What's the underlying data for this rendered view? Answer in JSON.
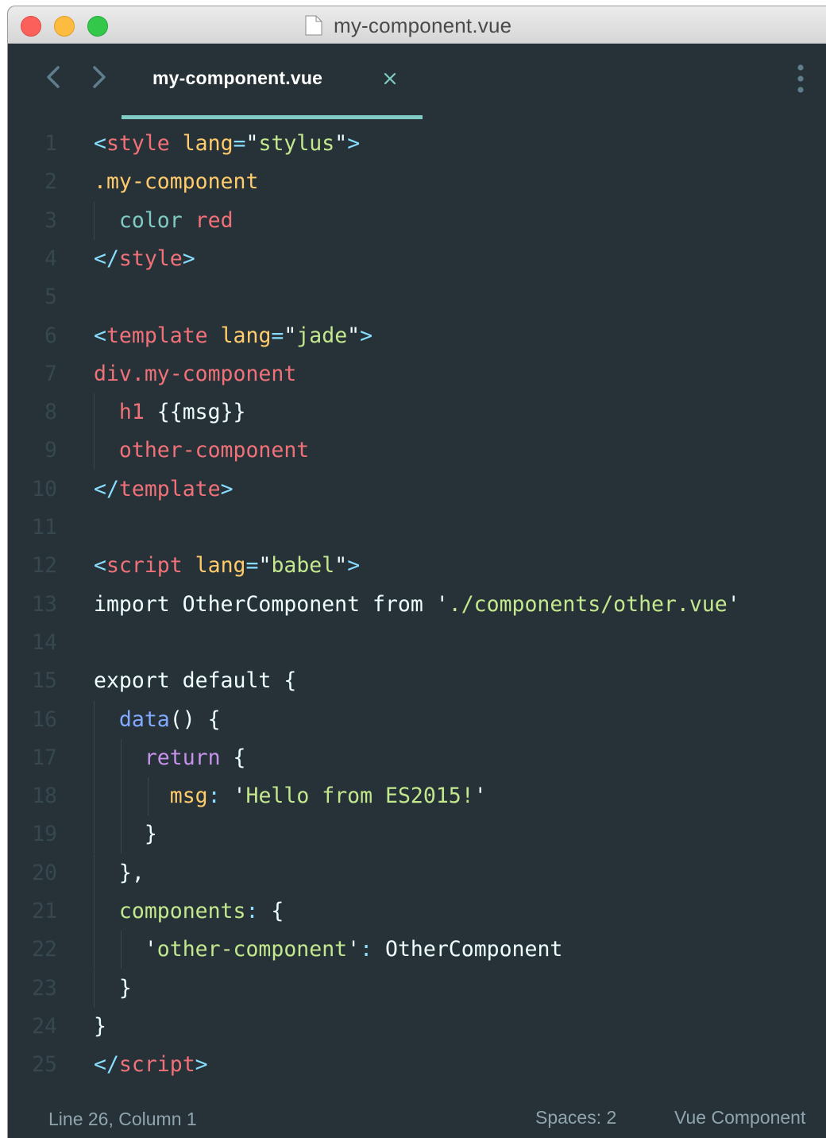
{
  "window": {
    "title": "my-component.vue",
    "title_icon": "document-icon"
  },
  "tabs": [
    {
      "label": "my-component.vue",
      "close_icon": "close-icon",
      "active": true
    }
  ],
  "nav": {
    "back_icon": "chevron-left-icon",
    "forward_icon": "chevron-right-icon",
    "menu_icon": "more-vertical-icon"
  },
  "colors": {
    "background": "#263238",
    "tab_accent": "#80cbc4",
    "tag": "#f07178",
    "punctuation": "#89ddff",
    "attribute": "#ffcb6b",
    "string": "#c3e88d",
    "keyword": "#c792ea",
    "function": "#82aaff",
    "property": "#80cbc4",
    "line_number": "#37474f"
  },
  "editor": {
    "lines": [
      {
        "n": "1",
        "tokens": [
          [
            "<",
            "p"
          ],
          [
            "style",
            "t"
          ],
          [
            " ",
            "x"
          ],
          [
            "lang",
            "a"
          ],
          [
            "=",
            "p"
          ],
          [
            "\"",
            "x"
          ],
          [
            "stylus",
            "s"
          ],
          [
            "\"",
            "x"
          ],
          [
            ">",
            "p"
          ]
        ]
      },
      {
        "n": "2",
        "tokens": [
          [
            ".my-component",
            "c"
          ]
        ]
      },
      {
        "n": "3",
        "tokens": [
          [
            "  ",
            "x"
          ],
          [
            "color",
            "r"
          ],
          [
            " ",
            "x"
          ],
          [
            "red",
            "t"
          ]
        ]
      },
      {
        "n": "4",
        "tokens": [
          [
            "</",
            "p"
          ],
          [
            "style",
            "t"
          ],
          [
            ">",
            "p"
          ]
        ]
      },
      {
        "n": "5",
        "tokens": []
      },
      {
        "n": "6",
        "tokens": [
          [
            "<",
            "p"
          ],
          [
            "template",
            "t"
          ],
          [
            " ",
            "x"
          ],
          [
            "lang",
            "a"
          ],
          [
            "=",
            "p"
          ],
          [
            "\"",
            "x"
          ],
          [
            "jade",
            "s"
          ],
          [
            "\"",
            "x"
          ],
          [
            ">",
            "p"
          ]
        ]
      },
      {
        "n": "7",
        "tokens": [
          [
            "div.my-component",
            "t"
          ]
        ]
      },
      {
        "n": "8",
        "tokens": [
          [
            "  ",
            "x"
          ],
          [
            "h1",
            "t"
          ],
          [
            " {{msg}}",
            "x"
          ]
        ]
      },
      {
        "n": "9",
        "tokens": [
          [
            "  ",
            "x"
          ],
          [
            "other-component",
            "t"
          ]
        ]
      },
      {
        "n": "10",
        "tokens": [
          [
            "</",
            "p"
          ],
          [
            "template",
            "t"
          ],
          [
            ">",
            "p"
          ]
        ]
      },
      {
        "n": "11",
        "tokens": []
      },
      {
        "n": "12",
        "tokens": [
          [
            "<",
            "p"
          ],
          [
            "script",
            "t"
          ],
          [
            " ",
            "x"
          ],
          [
            "lang",
            "a"
          ],
          [
            "=",
            "p"
          ],
          [
            "\"",
            "x"
          ],
          [
            "babel",
            "s"
          ],
          [
            "\"",
            "x"
          ],
          [
            ">",
            "p"
          ]
        ]
      },
      {
        "n": "13",
        "tokens": [
          [
            "import OtherComponent from ",
            "x"
          ],
          [
            "'",
            "x"
          ],
          [
            "./components/other.vue",
            "s"
          ],
          [
            "'",
            "x"
          ]
        ]
      },
      {
        "n": "14",
        "tokens": []
      },
      {
        "n": "15",
        "tokens": [
          [
            "export default {",
            "x"
          ]
        ]
      },
      {
        "n": "16",
        "tokens": [
          [
            "  ",
            "x"
          ],
          [
            "data",
            "f"
          ],
          [
            "() {",
            "x"
          ]
        ]
      },
      {
        "n": "17",
        "tokens": [
          [
            "    ",
            "x"
          ],
          [
            "return",
            "k"
          ],
          [
            " {",
            "x"
          ]
        ]
      },
      {
        "n": "18",
        "tokens": [
          [
            "      ",
            "x"
          ],
          [
            "msg",
            "c"
          ],
          [
            ":",
            "p"
          ],
          [
            " ",
            "x"
          ],
          [
            "'",
            "x"
          ],
          [
            "Hello from ES2015!",
            "s"
          ],
          [
            "'",
            "x"
          ]
        ]
      },
      {
        "n": "19",
        "tokens": [
          [
            "    }",
            "x"
          ]
        ]
      },
      {
        "n": "20",
        "tokens": [
          [
            "  },",
            "x"
          ]
        ]
      },
      {
        "n": "21",
        "tokens": [
          [
            "  ",
            "x"
          ],
          [
            "components",
            "s"
          ],
          [
            ":",
            "p"
          ],
          [
            " {",
            "x"
          ]
        ]
      },
      {
        "n": "22",
        "tokens": [
          [
            "    ",
            "x"
          ],
          [
            "'",
            "x"
          ],
          [
            "other-component",
            "s"
          ],
          [
            "'",
            "x"
          ],
          [
            ":",
            "p"
          ],
          [
            " OtherComponent",
            "x"
          ]
        ]
      },
      {
        "n": "23",
        "tokens": [
          [
            "  }",
            "x"
          ]
        ]
      },
      {
        "n": "24",
        "tokens": [
          [
            "}",
            "x"
          ]
        ]
      },
      {
        "n": "25",
        "tokens": [
          [
            "</",
            "p"
          ],
          [
            "script",
            "t"
          ],
          [
            ">",
            "p"
          ]
        ]
      }
    ]
  },
  "status": {
    "position": "Line 26, Column 1",
    "spaces": "Spaces: 2",
    "syntax": "Vue Component"
  }
}
